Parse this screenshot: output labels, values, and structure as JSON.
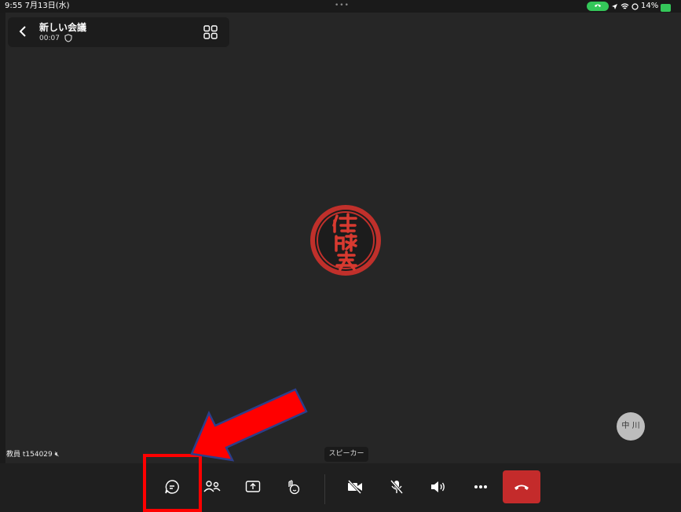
{
  "status_bar": {
    "time": "9:55 7月13日(水)",
    "dots": "•••",
    "battery_text": "14%"
  },
  "header": {
    "title": "新しい会議",
    "timer": "00:07"
  },
  "main": {
    "participant_label": "教員 t154029",
    "speaker_tooltip": "スピーカー",
    "small_avatar_initials": "中 川"
  },
  "toolbar": {
    "buttons": [
      "chat",
      "participants",
      "share",
      "reactions",
      "camera-off",
      "mic-off",
      "speaker",
      "more",
      "end-call"
    ]
  },
  "colors": {
    "background": "#262626",
    "end_call": "#c42b2b",
    "highlight": "#ff0000",
    "avatar": "#c0302b",
    "call_pill": "#34c759"
  }
}
